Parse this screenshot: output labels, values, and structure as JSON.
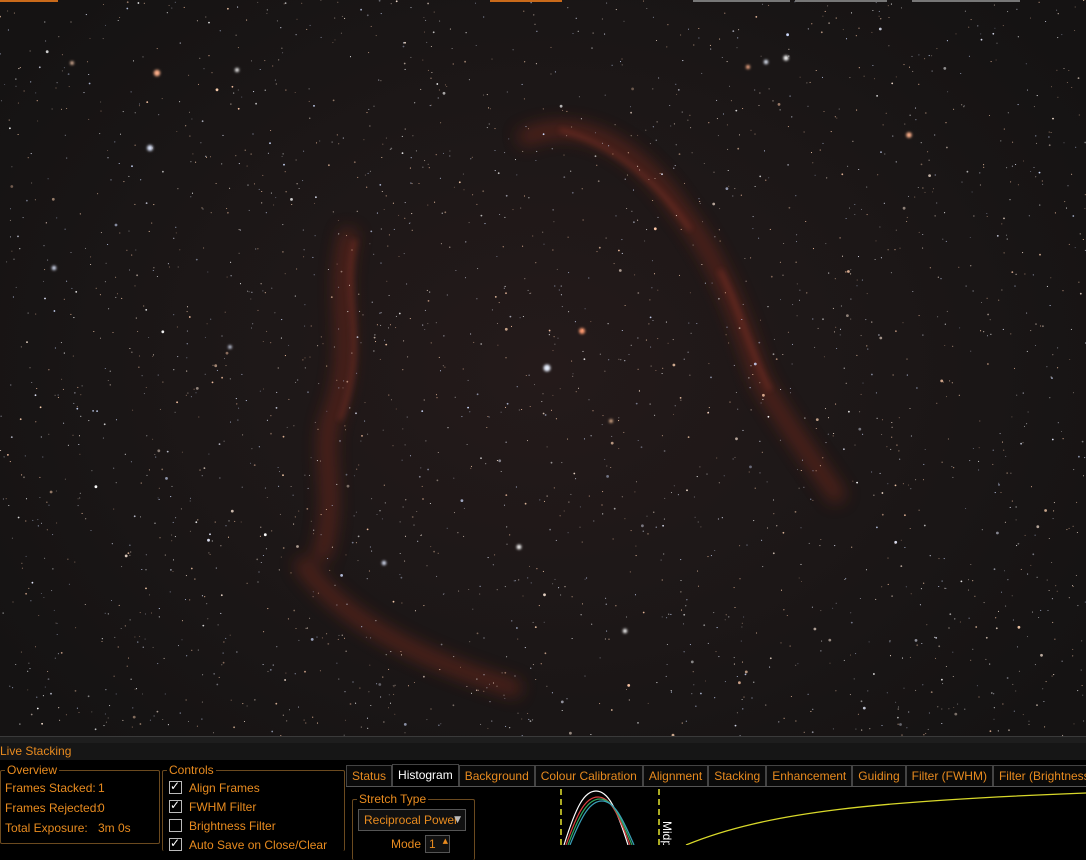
{
  "panel": {
    "title": "Live Stacking"
  },
  "overview": {
    "title": "Overview",
    "frames_stacked_label": "Frames Stacked:",
    "frames_stacked_value": "1",
    "frames_rejected_label": "Frames Rejected:",
    "frames_rejected_value": "0",
    "total_exposure_label": "Total Exposure:",
    "total_exposure_value": "3m 0s"
  },
  "controls": {
    "title": "Controls",
    "items": [
      {
        "label": "Align Frames",
        "checked": true
      },
      {
        "label": "FWHM Filter",
        "checked": true
      },
      {
        "label": "Brightness Filter",
        "checked": false
      },
      {
        "label": "Auto Save on Close/Clear",
        "checked": true
      }
    ]
  },
  "tabs": [
    {
      "label": "Status",
      "active": false
    },
    {
      "label": "Histogram",
      "active": true
    },
    {
      "label": "Background",
      "active": false
    },
    {
      "label": "Colour Calibration",
      "active": false
    },
    {
      "label": "Alignment",
      "active": false
    },
    {
      "label": "Stacking",
      "active": false
    },
    {
      "label": "Enhancement",
      "active": false
    },
    {
      "label": "Guiding",
      "active": false
    },
    {
      "label": "Filter (FWHM)",
      "active": false
    },
    {
      "label": "Filter (Brightness)",
      "active": false
    }
  ],
  "histogram": {
    "stretch_type_title": "Stretch Type",
    "stretch_type_value": "Reciprocal Power",
    "mode_label": "Mode",
    "mode_value": "1",
    "midpoint_label": "Midpoint"
  },
  "colors": {
    "accent": "#e88b1f",
    "marker": "#e6e62e",
    "curve": "#d8d82a"
  }
}
